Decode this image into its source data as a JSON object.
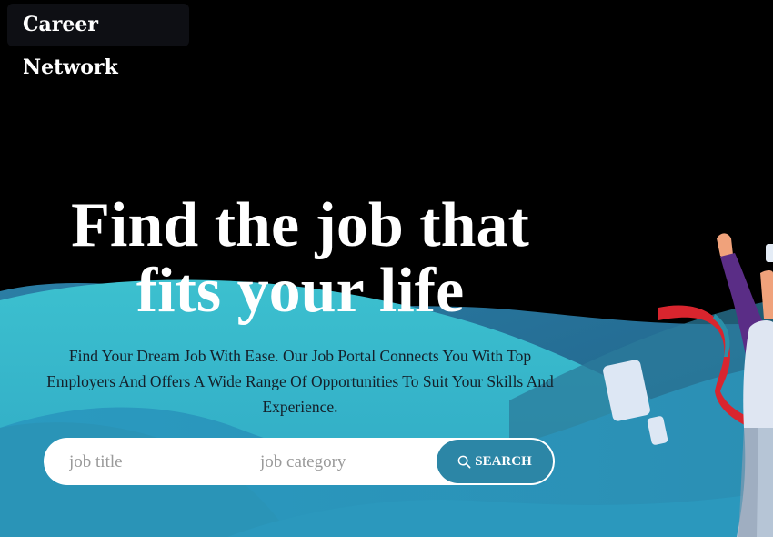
{
  "brand": {
    "name": "Career Network"
  },
  "hero": {
    "headline_line1": "Find the job that",
    "headline_line2": "fits your life",
    "subtitle": "Find Your Dream Job With Ease. Our Job Portal Connects You With Top Employers And Offers A Wide Range Of Opportunities To Suit Your Skills And Experience."
  },
  "search": {
    "title_placeholder": "job title",
    "category_placeholder": "job category",
    "button_label": "SEARCH",
    "button_icon": "search-icon"
  },
  "colors": {
    "background": "#000000",
    "wave_light": "#35b6c9",
    "wave_dark": "#2a8fb3",
    "button": "#2c86a6"
  }
}
